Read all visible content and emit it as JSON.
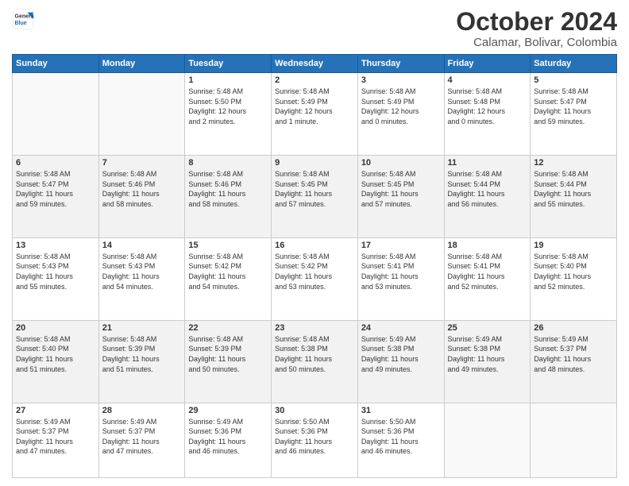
{
  "header": {
    "logo_line1": "General",
    "logo_line2": "Blue",
    "month": "October 2024",
    "location": "Calamar, Bolivar, Colombia"
  },
  "weekdays": [
    "Sunday",
    "Monday",
    "Tuesday",
    "Wednesday",
    "Thursday",
    "Friday",
    "Saturday"
  ],
  "rows": [
    [
      {
        "day": "",
        "info": ""
      },
      {
        "day": "",
        "info": ""
      },
      {
        "day": "1",
        "info": "Sunrise: 5:48 AM\nSunset: 5:50 PM\nDaylight: 12 hours\nand 2 minutes."
      },
      {
        "day": "2",
        "info": "Sunrise: 5:48 AM\nSunset: 5:49 PM\nDaylight: 12 hours\nand 1 minute."
      },
      {
        "day": "3",
        "info": "Sunrise: 5:48 AM\nSunset: 5:49 PM\nDaylight: 12 hours\nand 0 minutes."
      },
      {
        "day": "4",
        "info": "Sunrise: 5:48 AM\nSunset: 5:48 PM\nDaylight: 12 hours\nand 0 minutes."
      },
      {
        "day": "5",
        "info": "Sunrise: 5:48 AM\nSunset: 5:47 PM\nDaylight: 11 hours\nand 59 minutes."
      }
    ],
    [
      {
        "day": "6",
        "info": "Sunrise: 5:48 AM\nSunset: 5:47 PM\nDaylight: 11 hours\nand 59 minutes."
      },
      {
        "day": "7",
        "info": "Sunrise: 5:48 AM\nSunset: 5:46 PM\nDaylight: 11 hours\nand 58 minutes."
      },
      {
        "day": "8",
        "info": "Sunrise: 5:48 AM\nSunset: 5:46 PM\nDaylight: 11 hours\nand 58 minutes."
      },
      {
        "day": "9",
        "info": "Sunrise: 5:48 AM\nSunset: 5:45 PM\nDaylight: 11 hours\nand 57 minutes."
      },
      {
        "day": "10",
        "info": "Sunrise: 5:48 AM\nSunset: 5:45 PM\nDaylight: 11 hours\nand 57 minutes."
      },
      {
        "day": "11",
        "info": "Sunrise: 5:48 AM\nSunset: 5:44 PM\nDaylight: 11 hours\nand 56 minutes."
      },
      {
        "day": "12",
        "info": "Sunrise: 5:48 AM\nSunset: 5:44 PM\nDaylight: 11 hours\nand 55 minutes."
      }
    ],
    [
      {
        "day": "13",
        "info": "Sunrise: 5:48 AM\nSunset: 5:43 PM\nDaylight: 11 hours\nand 55 minutes."
      },
      {
        "day": "14",
        "info": "Sunrise: 5:48 AM\nSunset: 5:43 PM\nDaylight: 11 hours\nand 54 minutes."
      },
      {
        "day": "15",
        "info": "Sunrise: 5:48 AM\nSunset: 5:42 PM\nDaylight: 11 hours\nand 54 minutes."
      },
      {
        "day": "16",
        "info": "Sunrise: 5:48 AM\nSunset: 5:42 PM\nDaylight: 11 hours\nand 53 minutes."
      },
      {
        "day": "17",
        "info": "Sunrise: 5:48 AM\nSunset: 5:41 PM\nDaylight: 11 hours\nand 53 minutes."
      },
      {
        "day": "18",
        "info": "Sunrise: 5:48 AM\nSunset: 5:41 PM\nDaylight: 11 hours\nand 52 minutes."
      },
      {
        "day": "19",
        "info": "Sunrise: 5:48 AM\nSunset: 5:40 PM\nDaylight: 11 hours\nand 52 minutes."
      }
    ],
    [
      {
        "day": "20",
        "info": "Sunrise: 5:48 AM\nSunset: 5:40 PM\nDaylight: 11 hours\nand 51 minutes."
      },
      {
        "day": "21",
        "info": "Sunrise: 5:48 AM\nSunset: 5:39 PM\nDaylight: 11 hours\nand 51 minutes."
      },
      {
        "day": "22",
        "info": "Sunrise: 5:48 AM\nSunset: 5:39 PM\nDaylight: 11 hours\nand 50 minutes."
      },
      {
        "day": "23",
        "info": "Sunrise: 5:48 AM\nSunset: 5:38 PM\nDaylight: 11 hours\nand 50 minutes."
      },
      {
        "day": "24",
        "info": "Sunrise: 5:49 AM\nSunset: 5:38 PM\nDaylight: 11 hours\nand 49 minutes."
      },
      {
        "day": "25",
        "info": "Sunrise: 5:49 AM\nSunset: 5:38 PM\nDaylight: 11 hours\nand 49 minutes."
      },
      {
        "day": "26",
        "info": "Sunrise: 5:49 AM\nSunset: 5:37 PM\nDaylight: 11 hours\nand 48 minutes."
      }
    ],
    [
      {
        "day": "27",
        "info": "Sunrise: 5:49 AM\nSunset: 5:37 PM\nDaylight: 11 hours\nand 47 minutes."
      },
      {
        "day": "28",
        "info": "Sunrise: 5:49 AM\nSunset: 5:37 PM\nDaylight: 11 hours\nand 47 minutes."
      },
      {
        "day": "29",
        "info": "Sunrise: 5:49 AM\nSunset: 5:36 PM\nDaylight: 11 hours\nand 46 minutes."
      },
      {
        "day": "30",
        "info": "Sunrise: 5:50 AM\nSunset: 5:36 PM\nDaylight: 11 hours\nand 46 minutes."
      },
      {
        "day": "31",
        "info": "Sunrise: 5:50 AM\nSunset: 5:36 PM\nDaylight: 11 hours\nand 46 minutes."
      },
      {
        "day": "",
        "info": ""
      },
      {
        "day": "",
        "info": ""
      }
    ]
  ]
}
